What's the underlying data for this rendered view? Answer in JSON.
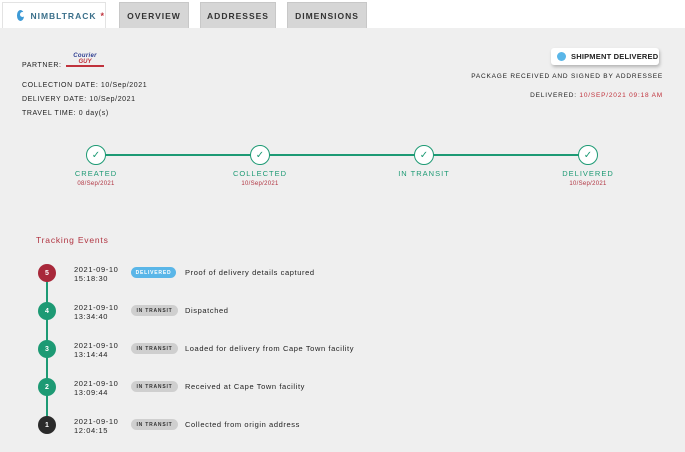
{
  "tabs": [
    {
      "label": "NIMBLTRACK",
      "marker": "*",
      "active": true,
      "icon": "location-pin-icon"
    },
    {
      "label": "OVERVIEW",
      "active": false
    },
    {
      "label": "ADDRESSES",
      "active": false
    },
    {
      "label": "DIMENSIONS",
      "active": false
    }
  ],
  "shipment": {
    "partner_label": "PARTNER:",
    "partner_logo_text_top": "Courier",
    "partner_logo_text_bottom": "GUY",
    "collection_label": "COLLECTION DATE:",
    "collection_value": "10/Sep/2021",
    "delivery_label": "DELIVERY DATE:",
    "delivery_value": "10/Sep/2021",
    "travel_label": "TRAVEL TIME:",
    "travel_value": "0 day(s)"
  },
  "status": {
    "badge": "SHIPMENT DELIVERED",
    "description": "PACKAGE RECEIVED AND SIGNED BY ADDRESSEE",
    "delivered_label": "DELIVERED:",
    "delivered_value": "10/SEP/2021 09:18 AM",
    "badge_color": "#5ab6e8"
  },
  "progress": [
    {
      "label": "CREATED",
      "date": "08/Sep/2021",
      "icon": "check-icon"
    },
    {
      "label": "COLLECTED",
      "date": "10/Sep/2021",
      "icon": "check-icon"
    },
    {
      "label": "IN TRANSIT",
      "date": "",
      "icon": "check-icon"
    },
    {
      "label": "DELIVERED",
      "date": "10/Sep/2021",
      "icon": "check-icon"
    }
  ],
  "events_title": "Tracking Events",
  "events": [
    {
      "num": "5",
      "date": "2021-09-10",
      "time": "15:18:30",
      "status": "DELIVERED",
      "description": "Proof of delivery details captured",
      "color": "#a8283a"
    },
    {
      "num": "4",
      "date": "2021-09-10",
      "time": "13:34:40",
      "status": "IN TRANSIT",
      "description": "Dispatched",
      "color": "#1d9a74"
    },
    {
      "num": "3",
      "date": "2021-09-10",
      "time": "13:14:44",
      "status": "IN TRANSIT",
      "description": "Loaded for delivery from Cape Town facility",
      "color": "#1d9a74"
    },
    {
      "num": "2",
      "date": "2021-09-10",
      "time": "13:09:44",
      "status": "IN TRANSIT",
      "description": "Received at Cape Town facility",
      "color": "#1d9a74"
    },
    {
      "num": "1",
      "date": "2021-09-10",
      "time": "12:04:15",
      "status": "IN TRANSIT",
      "description": "Collected from origin address",
      "color": "#2b2b2b"
    }
  ],
  "colors": {
    "accent": "#1d9a74",
    "highlight": "#b03340"
  }
}
